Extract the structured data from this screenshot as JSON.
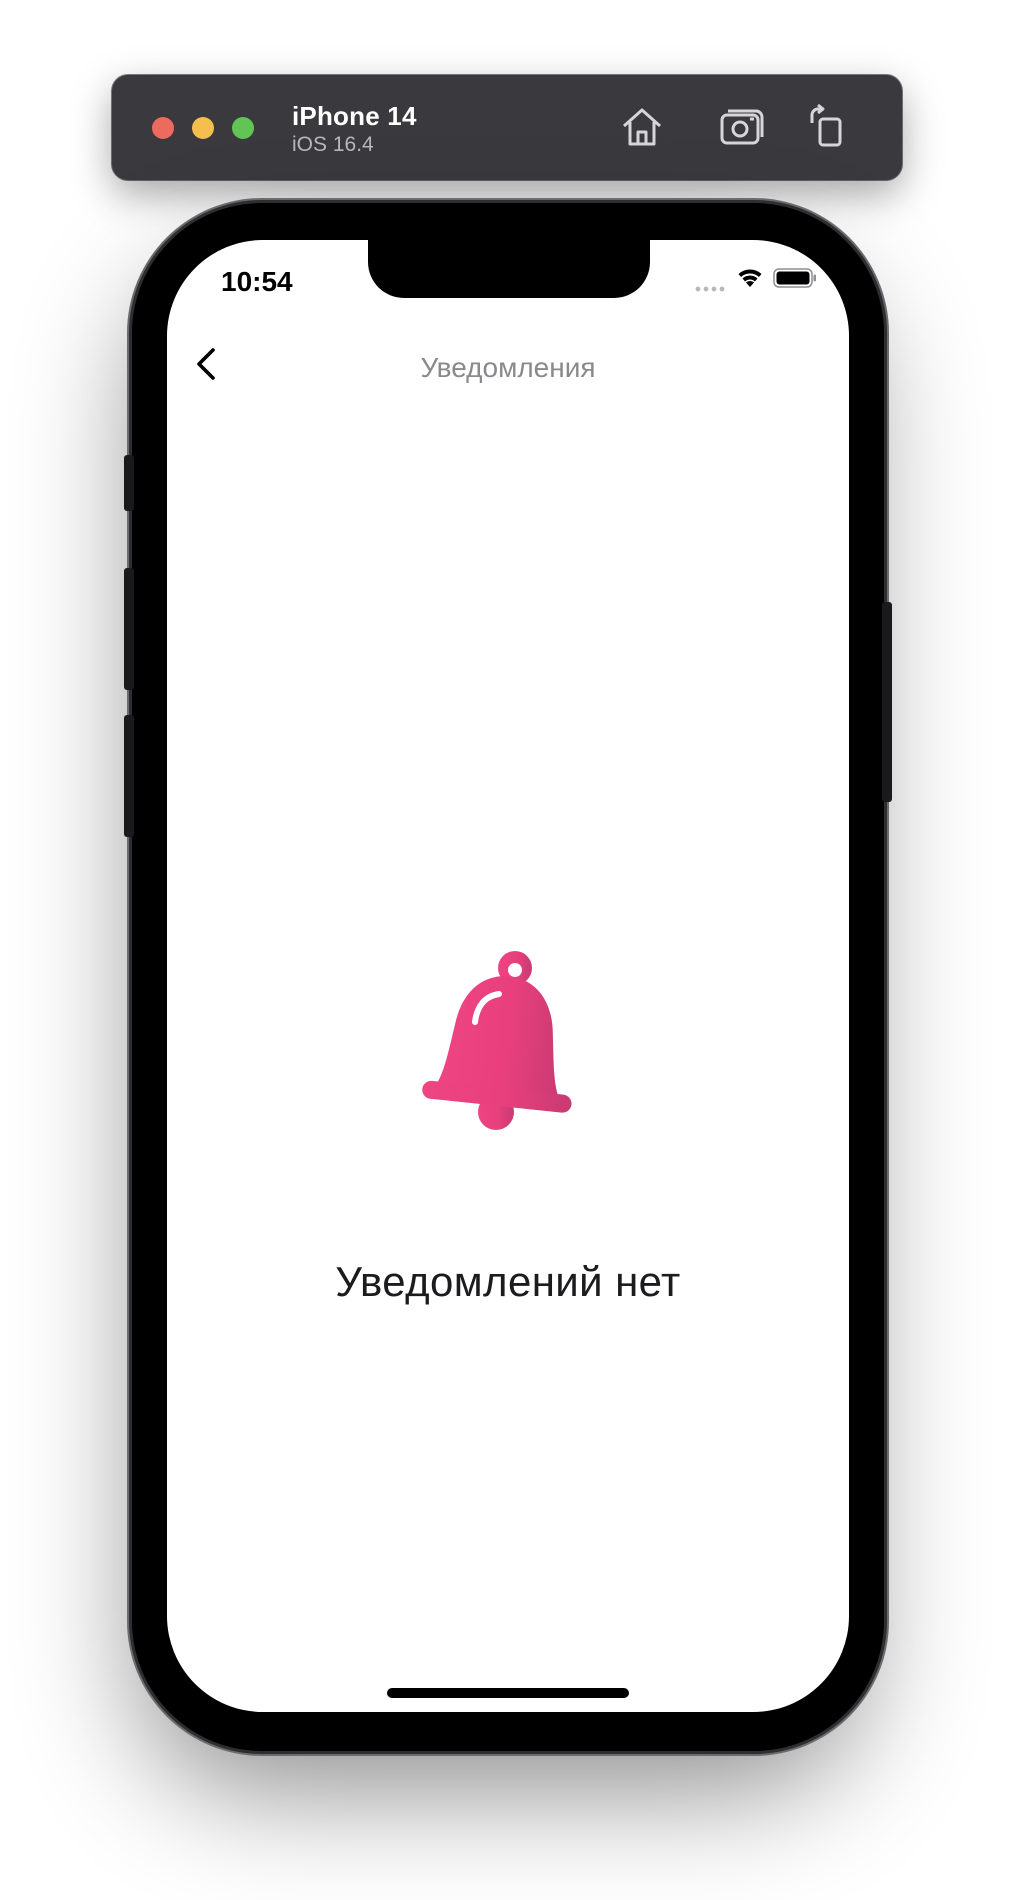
{
  "simulator": {
    "device_name": "iPhone 14",
    "os_version": "iOS 16.4",
    "toolbar": [
      "home-icon",
      "screenshot-icon",
      "rotate-icon"
    ]
  },
  "status_bar": {
    "time": "10:54"
  },
  "nav": {
    "title": "Уведомления",
    "back_icon": "chevron-left-icon"
  },
  "empty_state": {
    "icon": "bell-icon",
    "message": "Уведомлений нет",
    "accent_color": "#e8407c"
  }
}
